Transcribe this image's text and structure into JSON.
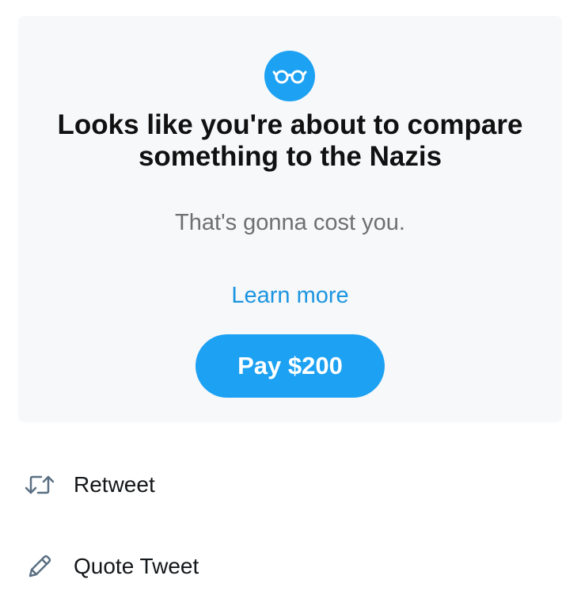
{
  "card": {
    "icon": "glasses-icon",
    "headline_line1": "Looks like you're about to compare",
    "headline_line2": "something to the Nazis",
    "subtext": "That's gonna cost you.",
    "learn_more_label": "Learn more",
    "pay_button_label": "Pay $200"
  },
  "menu": {
    "items": [
      {
        "label": "Retweet",
        "icon": "retweet-icon"
      },
      {
        "label": "Quote Tweet",
        "icon": "pencil-icon"
      }
    ]
  },
  "colors": {
    "accent": "#1da1f2",
    "link": "#1b95e0",
    "card_background": "#f7f8fa",
    "muted_text": "#6f6f6f"
  }
}
